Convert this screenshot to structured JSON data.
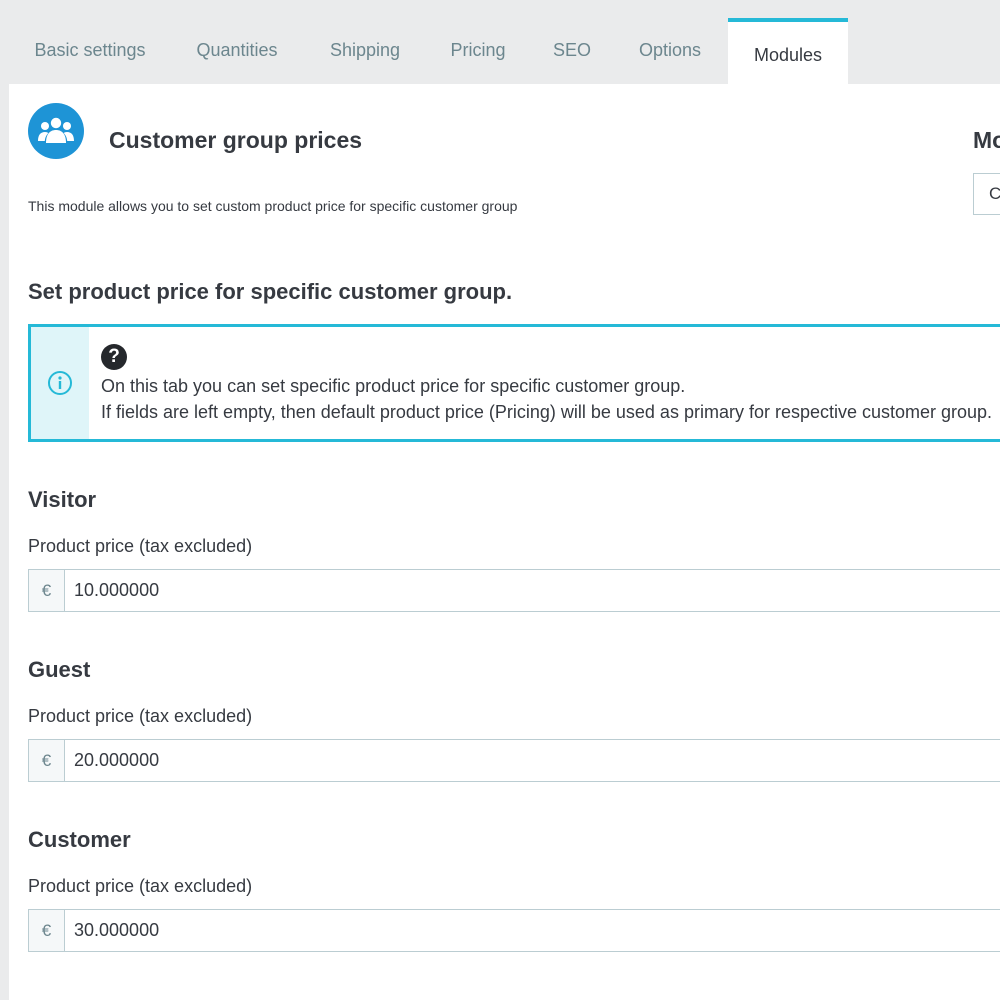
{
  "tabs": [
    {
      "label": "Basic settings",
      "active": false
    },
    {
      "label": "Quantities",
      "active": false
    },
    {
      "label": "Shipping",
      "active": false
    },
    {
      "label": "Pricing",
      "active": false
    },
    {
      "label": "SEO",
      "active": false
    },
    {
      "label": "Options",
      "active": false
    },
    {
      "label": "Modules",
      "active": true
    }
  ],
  "module": {
    "icon": "users-icon",
    "title": "Customer group prices",
    "description": "This module allows you to set custom product price for specific customer group"
  },
  "side_panel": {
    "title": "Mo",
    "select_value": "C"
  },
  "section": {
    "title": "Set product price for specific customer group."
  },
  "alert": {
    "side_icon": "info-icon",
    "help_icon": "question-circle-icon",
    "help_glyph": "?",
    "line1": "On this tab you can set specific product price for specific customer group.",
    "line2": "If fields are left empty, then default product price (Pricing) will be used as primary for respective customer group."
  },
  "colors": {
    "accent": "#25b9d7",
    "module_icon_bg": "#1e94d6",
    "alert_side_bg": "#dff5f9"
  },
  "groups": [
    {
      "name": "Visitor",
      "label": "Product price (tax excluded)",
      "currency": "€",
      "value": "10.000000"
    },
    {
      "name": "Guest",
      "label": "Product price (tax excluded)",
      "currency": "€",
      "value": "20.000000"
    },
    {
      "name": "Customer",
      "label": "Product price (tax excluded)",
      "currency": "€",
      "value": "30.000000"
    }
  ]
}
